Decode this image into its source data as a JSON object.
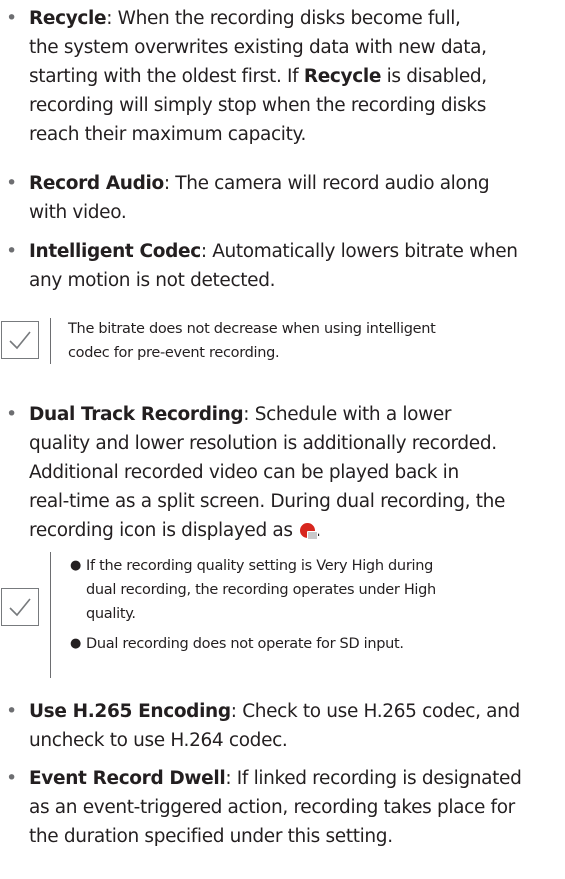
{
  "items": {
    "recycle": {
      "term": "Recycle",
      "line1": ": When the recording disks become full,",
      "line2": "the system overwrites existing data with new data,",
      "line3a": "starting with the oldest first. If ",
      "line3term": "Recycle",
      "line3b": " is disabled,",
      "line4": "recording will simply stop when the recording disks",
      "line5": "reach their maximum capacity."
    },
    "record_audio": {
      "term": "Record Audio",
      "line1": ": The camera will record audio along",
      "line2": "with video."
    },
    "intelligent_codec": {
      "term": "Intelligent Codec",
      "line1": ": Automatically lowers bitrate when",
      "line2": "any motion is not detected."
    },
    "dual_track": {
      "term": "Dual Track Recording",
      "line1": ": Schedule with a lower",
      "line2": "quality and lower resolution is additionally recorded.",
      "line3": "Additional recorded video can be played back in",
      "line4": "real-time as a split screen. During dual recording, the",
      "line5": "recording icon is displayed as ",
      "line5end": "."
    },
    "h265": {
      "term": "Use H.265 Encoding",
      "line1": ": Check to use H.265 codec, and",
      "line2": "uncheck to use H.264 codec."
    },
    "event_dwell": {
      "term": "Event Record Dwell",
      "line1": ": If linked recording is designated",
      "line2": "as an event-triggered action, recording takes place for",
      "line3": "the duration specified under this setting."
    }
  },
  "notes": {
    "note1": {
      "line1": "The bitrate does not decrease when using intelligent",
      "line2": "codec for pre-event recording."
    },
    "note2": {
      "sub1_line1": "If the recording quality setting is Very High during",
      "sub1_line2": "dual recording, the recording operates under High",
      "sub1_line3": "quality.",
      "sub2_line1": "Dual recording does not operate for SD input."
    }
  },
  "colors": {
    "text": "#231f20",
    "bullet": "#6d6e71",
    "note_border": "#777a7d",
    "record_icon": "#d7261e"
  },
  "icons": {
    "note": "checkmark-icon",
    "record": "dual-recording-icon"
  }
}
